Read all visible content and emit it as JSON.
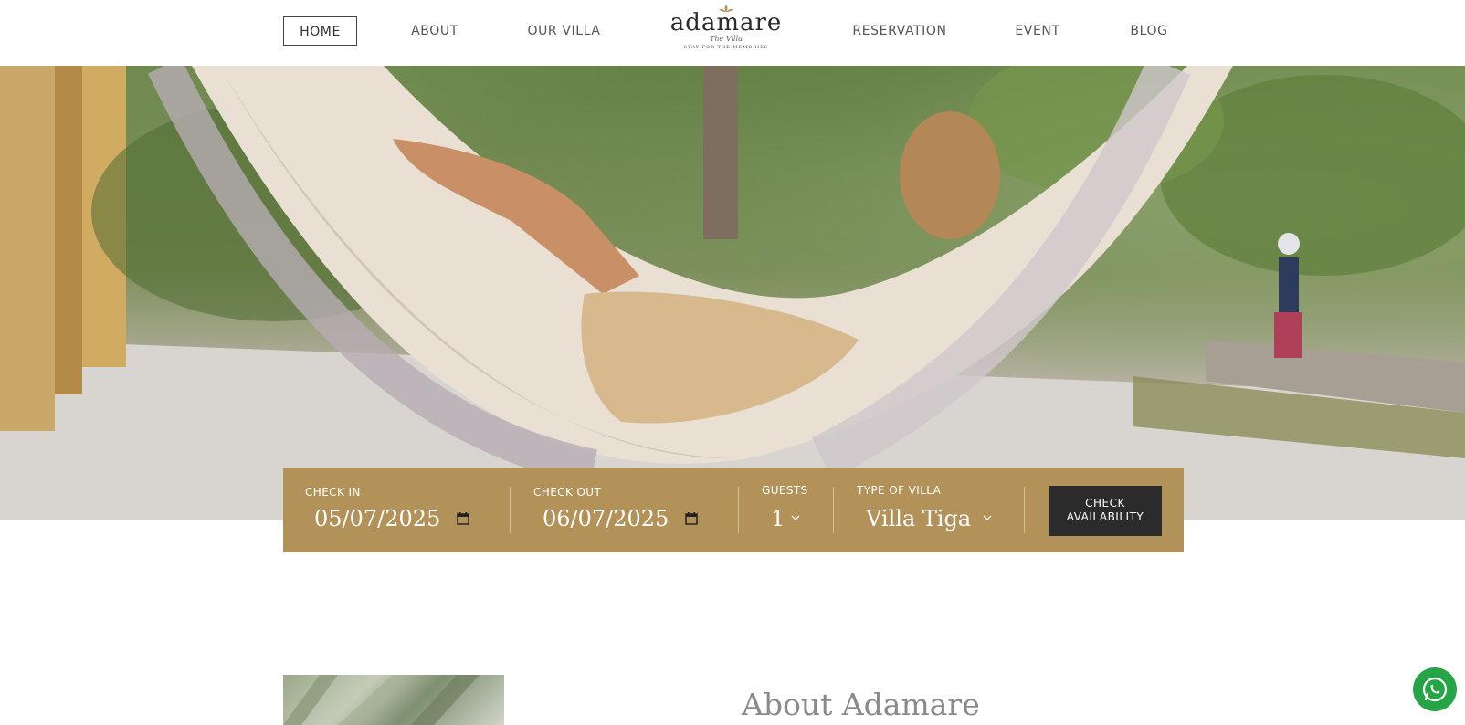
{
  "nav": {
    "left_items": [
      {
        "label": "HOME",
        "active": true
      },
      {
        "label": "ABOUT"
      },
      {
        "label": "OUR VILLA"
      }
    ],
    "right_items": [
      {
        "label": "RESERVATION"
      },
      {
        "label": "EVENT"
      },
      {
        "label": "BLOG"
      }
    ]
  },
  "logo": {
    "name": "adamare",
    "subtitle": "The Villa",
    "tagline": "STAY FOR THE MEMORIES"
  },
  "booking": {
    "check_in": {
      "label": "CHECK IN",
      "value": "05/07/2025"
    },
    "check_out": {
      "label": "CHECK OUT",
      "value": "06/07/2025"
    },
    "guests": {
      "label": "GUESTS",
      "value": "1"
    },
    "villa_type": {
      "label": "TYPE OF VILLA",
      "value": "Villa Tiga"
    },
    "button_line1": "CHECK",
    "button_line2": "AVAILABILITY"
  },
  "about": {
    "title": "About Adamare"
  },
  "colors": {
    "accent": "#b39259",
    "button_dark": "#2b2b2b",
    "whatsapp": "#26a546"
  },
  "icons": [
    "calendar-icon",
    "chevron-down-icon",
    "whatsapp-icon"
  ]
}
